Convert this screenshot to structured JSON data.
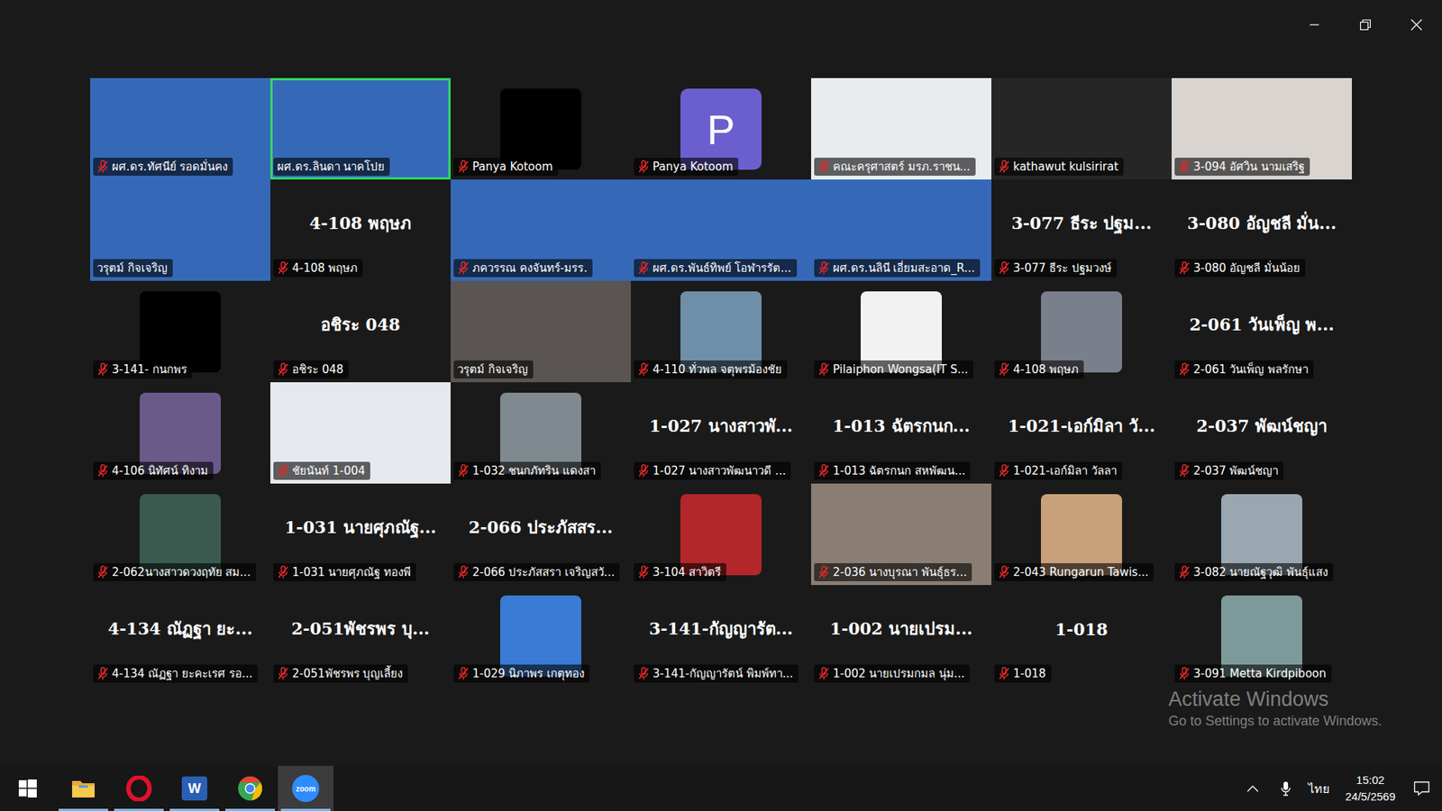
{
  "gallery": {
    "tiles": [
      {
        "kind": "video",
        "label": "ผศ.ดร.ทัศนีย์ รอดมั่นคง",
        "muted": true,
        "speaking": false,
        "color": "#3569b8"
      },
      {
        "kind": "video",
        "label": "ผศ.ดร.ลินดา นาคโปย",
        "muted": false,
        "speaking": true,
        "color": "#3569b8"
      },
      {
        "kind": "profile",
        "label": "Panya Kotoom",
        "muted": true,
        "speaking": false,
        "color": "#000000"
      },
      {
        "kind": "avatar",
        "label": "Panya Kotoom",
        "muted": true,
        "speaking": false,
        "color": "#6b5fd0",
        "letter": "P"
      },
      {
        "kind": "video",
        "label": "คณะครุศาสตร์ มรภ.ราชน...",
        "muted": true,
        "speaking": false,
        "color": "#e9ecef"
      },
      {
        "kind": "empty",
        "label": "kathawut kulsirirat",
        "muted": true,
        "speaking": false
      },
      {
        "kind": "video",
        "label": "3-094 อัศวิน นามเสริฐ",
        "muted": true,
        "speaking": false,
        "color": "#d9d4cf"
      },
      {
        "kind": "video",
        "label": "วรุตม์ กิจเจริญ",
        "muted": false,
        "speaking": false,
        "color": "#3569b8"
      },
      {
        "kind": "name",
        "big": "4-108 พฤษภ",
        "label": "4-108 พฤษภ",
        "muted": true,
        "speaking": false
      },
      {
        "kind": "video",
        "label": "ภควรรณ คงจันทร์-มรร.",
        "muted": true,
        "speaking": false,
        "color": "#3569b8"
      },
      {
        "kind": "video",
        "label": "ผศ.ดร.พันธ์ทิพย์ โอฬารรัต...",
        "muted": true,
        "speaking": false,
        "color": "#3569b8"
      },
      {
        "kind": "video",
        "label": "ผศ.ดร.นลินี เอี่ยมสะอาด_R...",
        "muted": true,
        "speaking": false,
        "color": "#3569b8"
      },
      {
        "kind": "name",
        "big": "3-077 ธีระ ปฐม...",
        "label": "3-077 ธีระ ปฐมวงษ์",
        "muted": true,
        "speaking": false
      },
      {
        "kind": "name",
        "big": "3-080 อัญชลี มั่น...",
        "label": "3-080 อัญชลี มั่นน้อย",
        "muted": true,
        "speaking": false
      },
      {
        "kind": "profile",
        "label": "3-141- กนกพร",
        "muted": true,
        "speaking": false,
        "color": "#000000"
      },
      {
        "kind": "name",
        "big": "อชิระ 048",
        "label": "อชิระ 048",
        "muted": true,
        "speaking": false
      },
      {
        "kind": "video",
        "label": "วรุตม์ กิจเจริญ",
        "muted": false,
        "speaking": false,
        "color": "#5a5552"
      },
      {
        "kind": "profile",
        "label": "4-110 ทั่วพล จตุพรม้องชัย",
        "muted": true,
        "speaking": false,
        "color": "#6f8fa8"
      },
      {
        "kind": "profile",
        "label": "Pilaiphon Wongsa(IT S...",
        "muted": true,
        "speaking": false,
        "color": "#f2f2f2"
      },
      {
        "kind": "profile",
        "label": "4-108 พฤษภ",
        "muted": true,
        "speaking": false,
        "color": "#7a7f8c"
      },
      {
        "kind": "name",
        "big": "2-061 วันเพ็ญ พ...",
        "label": "2-061 วันเพ็ญ พลรักษา",
        "muted": true,
        "speaking": false
      },
      {
        "kind": "profile",
        "label": "4-106 นิทัศน์ ทิงาม",
        "muted": true,
        "speaking": false,
        "color": "#6a5a8a"
      },
      {
        "kind": "video",
        "label": "ชัยนันท์ 1-004",
        "muted": true,
        "speaking": false,
        "color": "#e6e8ee"
      },
      {
        "kind": "profile",
        "label": "1-032 ชนกภัทริน แดงสา",
        "muted": true,
        "speaking": false,
        "color": "#7f8a90"
      },
      {
        "kind": "name",
        "big": "1-027 นางสาวพั...",
        "label": "1-027 นางสาวพัฒนาวดี ...",
        "muted": true,
        "speaking": false
      },
      {
        "kind": "name",
        "big": "1-013 ฉัตรกนก...",
        "label": "1-013 ฉัตรกนก สหพัฒน...",
        "muted": true,
        "speaking": false
      },
      {
        "kind": "name",
        "big": "1-021-เอก์มิลา วั...",
        "label": "1-021-เอก์มิลา วัลลา",
        "muted": true,
        "speaking": false
      },
      {
        "kind": "name",
        "big": "2-037 พัฒน์ชญา",
        "label": "2-037 พัฒน์ชญา",
        "muted": true,
        "speaking": false
      },
      {
        "kind": "profile",
        "label": "2-062นางสาวดวงฤทัย สม...",
        "muted": true,
        "speaking": false,
        "color": "#3a5a4f"
      },
      {
        "kind": "name",
        "big": "1-031 นายศุภณัฐ...",
        "label": "1-031 นายศุภณัฐ ทองพี",
        "muted": true,
        "speaking": false
      },
      {
        "kind": "name",
        "big": "2-066 ประภัสสร...",
        "label": "2-066 ประภัสสรา เจริญสวั...",
        "muted": true,
        "speaking": false
      },
      {
        "kind": "profile",
        "label": "3-104 สาวิตรี",
        "muted": true,
        "speaking": false,
        "color": "#b3262a"
      },
      {
        "kind": "video",
        "label": "2-036 นางบุรณา พันธุ์ธร...",
        "muted": true,
        "speaking": false,
        "color": "#8a7e74"
      },
      {
        "kind": "profile",
        "label": "2-043 Rungarun Tawis...",
        "muted": true,
        "speaking": false,
        "color": "#c8a07a"
      },
      {
        "kind": "profile",
        "label": "3-082 นายณัฐวุฒิ พันธุ์แสง",
        "muted": true,
        "speaking": false,
        "color": "#9aa6b0"
      },
      {
        "kind": "name",
        "big": "4-134 ณัฏฐา ยะ...",
        "label": "4-134 ณัฏฐา ยะคะเรศ รอ...",
        "muted": true,
        "speaking": false
      },
      {
        "kind": "name",
        "big": "2-051พัชรพร บุ...",
        "label": "2-051พัชรพร บุญเลี้ยง",
        "muted": true,
        "speaking": false
      },
      {
        "kind": "profile",
        "label": "1-029 นิภาพร เกตุทอง",
        "muted": true,
        "speaking": false,
        "color": "#3a7bd5"
      },
      {
        "kind": "name",
        "big": "3-141-กัญญารัต...",
        "label": "3-141-กัญญารัตน์ พิมพ์ทา...",
        "muted": true,
        "speaking": false
      },
      {
        "kind": "name",
        "big": "1-002 นายเปรม...",
        "label": "1-002 นายเปรมกมล นุ่ม...",
        "muted": true,
        "speaking": false
      },
      {
        "kind": "name",
        "big": "1-018",
        "label": "1-018",
        "muted": true,
        "speaking": false
      },
      {
        "kind": "profile",
        "label": "3-091 Metta Kirdpiboon",
        "muted": true,
        "speaking": false,
        "color": "#7d9a9a"
      }
    ]
  },
  "watermark": {
    "title": "Activate Windows",
    "subtitle": "Go to Settings to activate Windows."
  },
  "taskbar": {
    "apps": [
      {
        "kind": "start",
        "running": false,
        "active": false
      },
      {
        "kind": "explorer",
        "running": true,
        "active": false
      },
      {
        "kind": "opera",
        "running": true,
        "active": false
      },
      {
        "kind": "word",
        "running": true,
        "active": false,
        "text": "W"
      },
      {
        "kind": "chrome",
        "running": true,
        "active": false
      },
      {
        "kind": "zoom",
        "running": true,
        "active": true,
        "text": "zoom"
      }
    ],
    "language": "ไทย",
    "time": "15:02",
    "date": "24/5/2569"
  }
}
